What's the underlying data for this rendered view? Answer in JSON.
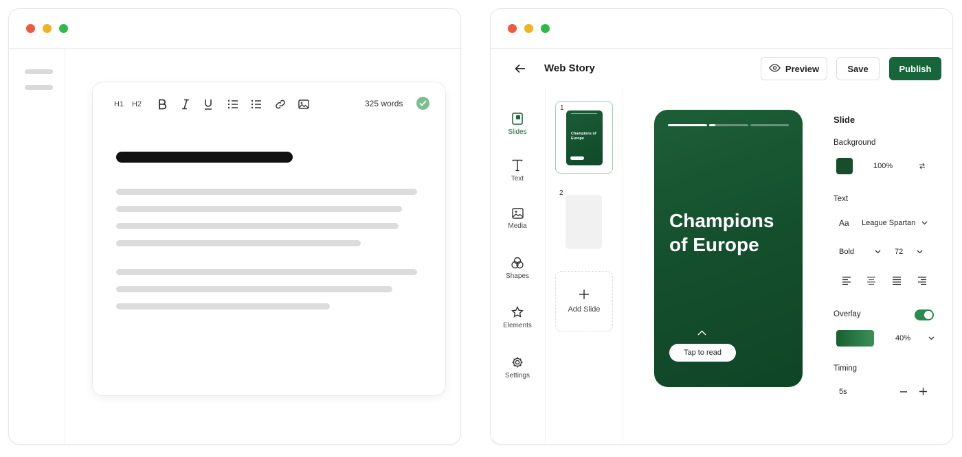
{
  "editor": {
    "toolbar": {
      "h1_label": "H1",
      "h2_label": "H2",
      "word_count": "325 words"
    }
  },
  "story": {
    "title": "Web Story",
    "buttons": {
      "preview": "Preview",
      "save": "Save",
      "publish": "Publish"
    },
    "tools": [
      "Slides",
      "Text",
      "Media",
      "Shapes",
      "Elements",
      "Settings"
    ],
    "slides": [
      {
        "number": "1",
        "text": "Champions of Europe"
      },
      {
        "number": "2"
      }
    ],
    "add_slide": "Add Slide",
    "canvas": {
      "headline": "Champions of Europe",
      "cta": "Tap to read"
    },
    "panel": {
      "heading": "Slide",
      "background_label": "Background",
      "background_opacity": "100%",
      "text_label": "Text",
      "font_icon_label": "Aa",
      "font_family": "League Spartan",
      "font_weight": "Bold",
      "font_size": "72",
      "overlay_label": "Overlay",
      "overlay_enabled": true,
      "overlay_opacity": "40%",
      "timing_label": "Timing",
      "timing_value": "5s"
    },
    "colors": {
      "accent": "#17653a",
      "slide_bg": "#174d2b"
    }
  }
}
